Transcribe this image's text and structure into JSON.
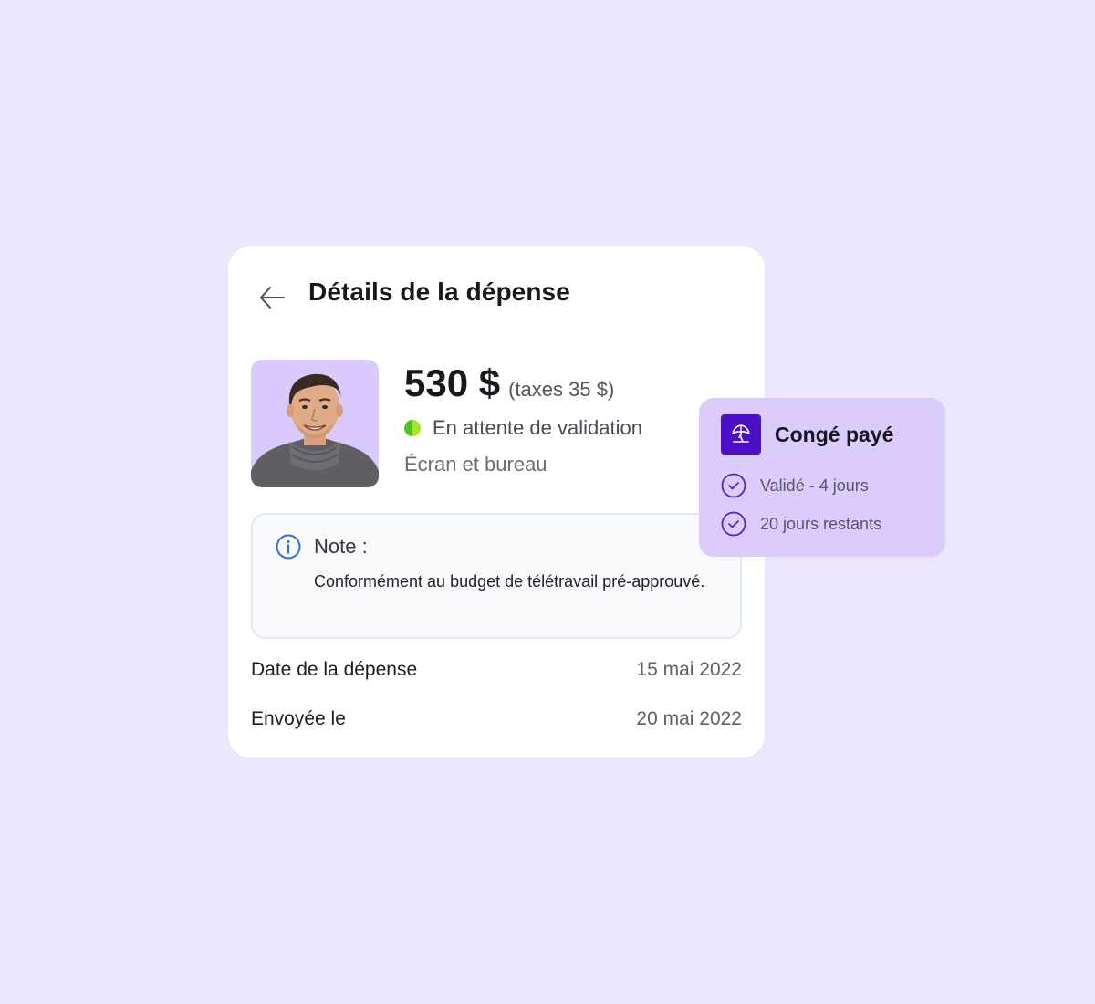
{
  "expense": {
    "title": "Détails de la dépense",
    "amount": "530 $",
    "taxes": "(taxes 35 $)",
    "status": "En attente de validation",
    "category": "Écran et bureau",
    "note_title": "Note :",
    "note_text": "Conformément au budget de télétravail pré-approuvé.",
    "details": [
      {
        "label": "Date de la dépense",
        "value": "15 mai 2022"
      },
      {
        "label": "Envoyée le",
        "value": "20 mai 2022"
      }
    ]
  },
  "leave": {
    "title": "Congé payé",
    "items": [
      {
        "text": "Validé - 4 jours"
      },
      {
        "text": "20 jours restants"
      }
    ]
  },
  "icons": {
    "back": "arrow-left-icon",
    "avatar": "user-avatar",
    "status": "status-dot",
    "note": "info-icon",
    "leave": "beach-umbrella-icon",
    "leave_items": "check-circle-icon"
  },
  "colors": {
    "background": "#ece6ff",
    "card": "#ffffff",
    "leave_card": "#dccbfd",
    "brand": "#4a0fc7",
    "status_dot": "#52c41a",
    "note_icon": "#2f6fd6",
    "check_icon": "#5b21c8"
  }
}
